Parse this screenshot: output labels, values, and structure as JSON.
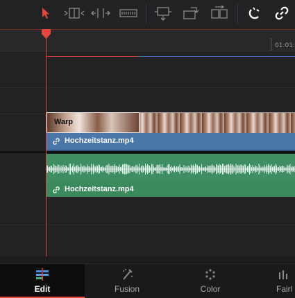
{
  "toolbar": {
    "icons": [
      "selection-arrow-icon",
      "trim-edit-icon",
      "dynamic-trim-icon",
      "blade-icon",
      "insert-clip-icon",
      "overwrite-clip-icon",
      "replace-clip-icon",
      "snapping-icon",
      "linked-selection-icon"
    ]
  },
  "timeline": {
    "ruler_timecode": "01:01:",
    "video_clip": {
      "effect_label": "Warp",
      "name": "Hochzeitstanz.mp4"
    },
    "audio_clip": {
      "name": "Hochzeitstanz.mp4"
    }
  },
  "pages": {
    "tabs": [
      {
        "label": "Edit",
        "icon": "edit-page-icon",
        "active": true
      },
      {
        "label": "Fusion",
        "icon": "fusion-page-icon",
        "active": false
      },
      {
        "label": "Color",
        "icon": "color-page-icon",
        "active": false
      },
      {
        "label": "Fairl",
        "icon": "fairlight-page-icon",
        "active": false
      }
    ]
  },
  "colors": {
    "accent_red": "#e5463a",
    "video_clip": "#4a76a8",
    "audio_clip": "#3f8e63"
  }
}
